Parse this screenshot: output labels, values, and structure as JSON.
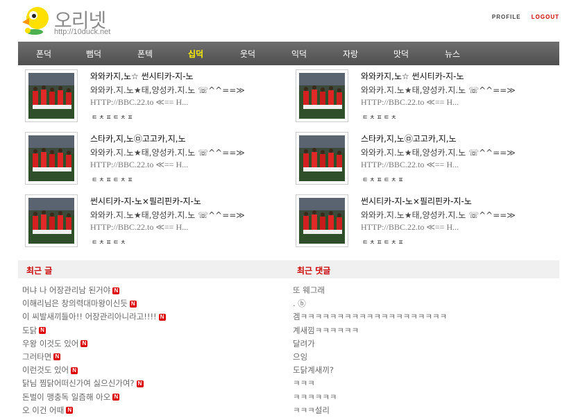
{
  "header": {
    "brand": "오리넷",
    "url": "http://10duck.net",
    "links": {
      "profile": "PROFILE",
      "logout": "LOGOUT"
    }
  },
  "nav": {
    "items": [
      "폰덕",
      "뻠덕",
      "폰텍",
      "십덕",
      "웃덕",
      "익덕",
      "자랑",
      "맛덕",
      "뉴스"
    ],
    "active": "십덕"
  },
  "posts": [
    {
      "title": "와와카지,노☆ 썬시티카-지-노",
      "desc": "와와카.지.노★태,양성카.지.노 ☏^^==≫",
      "link": "HTTP://BBC.22.to ≪== H...",
      "tags": "ㅌㅊㅍㅌㅊㅍ"
    },
    {
      "title": "와와카지,노☆ 썬시티카-지-노",
      "desc": "와와카.지.노★태,양성카.지.노 ☏^^==≫",
      "link": "HTTP://BBC.22.to ≪== H...",
      "tags": "ㅌㅊㅍㅌㅊ"
    },
    {
      "title": "스타카,지,노㉤고고카,지,노",
      "desc": "와와카.지.노★태,양성카.지.노 ☏^^==≫",
      "link": "HTTP://BBC.22.to ≪== H...",
      "tags": "ㅌㅊㅍㅌㅊㅍ"
    },
    {
      "title": "스타카,지,노㉤고고카,지,노",
      "desc": "와와카.지.노★태,양성카.지.노 ☏^^==≫",
      "link": "HTTP://BBC.22.to ≪== H...",
      "tags": "ㅌㅊㅍㅌㅊㅍ"
    },
    {
      "title": "썬시티카-지-노×필리핀카-지-노",
      "desc": "와와카.지.노★태,양성카.지.노 ☏^^==≫",
      "link": "HTTP://BBC.22.to ≪== H...",
      "tags": "ㅌㅊㅍㅌㅊ"
    },
    {
      "title": "썬시티카-지-노×필리핀카-지-노",
      "desc": "와와카.지.노★태,양성카.지.노 ☏^^==≫",
      "link": "HTTP://BBC.22.to ≪== H...",
      "tags": "ㅌㅊㅍㅌㅊㅍ"
    }
  ],
  "recent_posts": {
    "heading": "최근 글",
    "new_badge": "N",
    "items": [
      "머냐 나 어장관리남 된거야",
      "이해리님은 창의력대마왕이신듯",
      "이 씨발새끼들아!! 어장관리아니라고!!!!",
      "도닭",
      "우왕 이것도 있어",
      "그러타면",
      "이런것도 있어",
      "닭님 찜닭어떠신가여 싫으신가여?",
      "돈벌이 맹충독 일즘해 아오",
      "오 이건 어때"
    ]
  },
  "recent_comments": {
    "heading": "최근 댓글",
    "items": [
      "또 웨그래",
      ". ⓑ",
      "겜ㅋㅋㅋㅋㅋㅋㅋㅋㅋㅋㅋㅋㅋㅋㅋㅋㅋㅋㅋㅋ",
      "계새낌ㅋㅋㅋㅋㅋㅋ",
      "달려가",
      "으잉",
      "도닭계새끼?",
      "ㅋㅋㅋ",
      "ㅋㅋㅋㅋㅋㅋ",
      "ㅋㅋㅋ설리"
    ]
  },
  "colors": {
    "nav_bg": "#5a5a5a",
    "nav_active": "#ffee00",
    "heading_red": "#cc0000",
    "badge_red": "#dd0000"
  },
  "icons": {
    "logo": "duck-mascot-icon",
    "badge": "new-badge-icon"
  }
}
